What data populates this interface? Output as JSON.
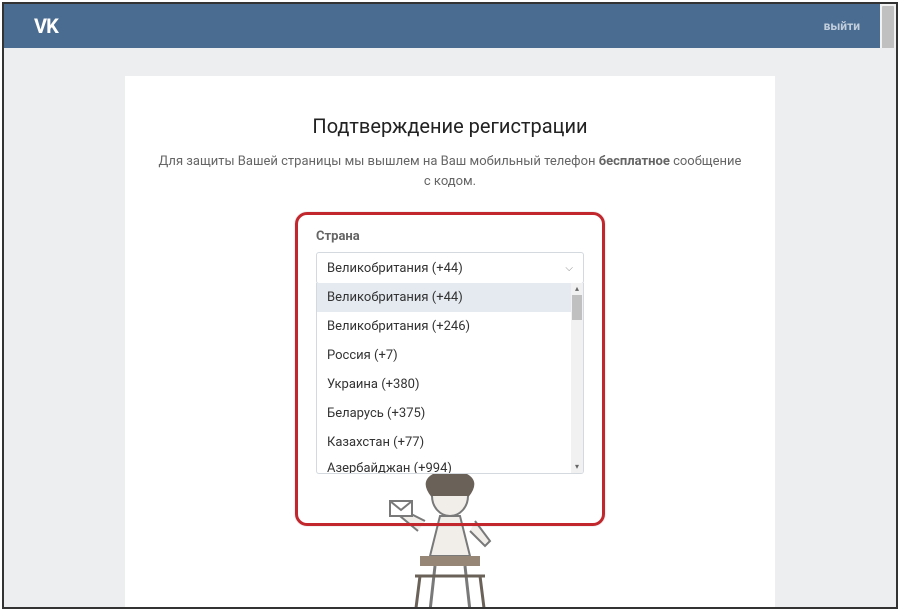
{
  "header": {
    "logo": "VK",
    "exit": "выйти"
  },
  "main": {
    "title": "Подтверждение регистрации",
    "subtitle_before": "Для защиты Вашей страницы мы вышлем на Ваш мобильный телефон ",
    "subtitle_bold": "бесплатное",
    "subtitle_after": " сообщение с кодом."
  },
  "country": {
    "label": "Страна",
    "selected": "Великобритания (+44)",
    "options": [
      {
        "label": "Великобритания (+44)",
        "selected": true
      },
      {
        "label": "Великобритания (+246)",
        "selected": false
      },
      {
        "label": "Россия (+7)",
        "selected": false
      },
      {
        "label": "Украина (+380)",
        "selected": false
      },
      {
        "label": "Беларусь (+375)",
        "selected": false
      },
      {
        "label": "Казахстан (+77)",
        "selected": false
      },
      {
        "label": "Азербайджан (+994)",
        "selected": false
      }
    ]
  }
}
